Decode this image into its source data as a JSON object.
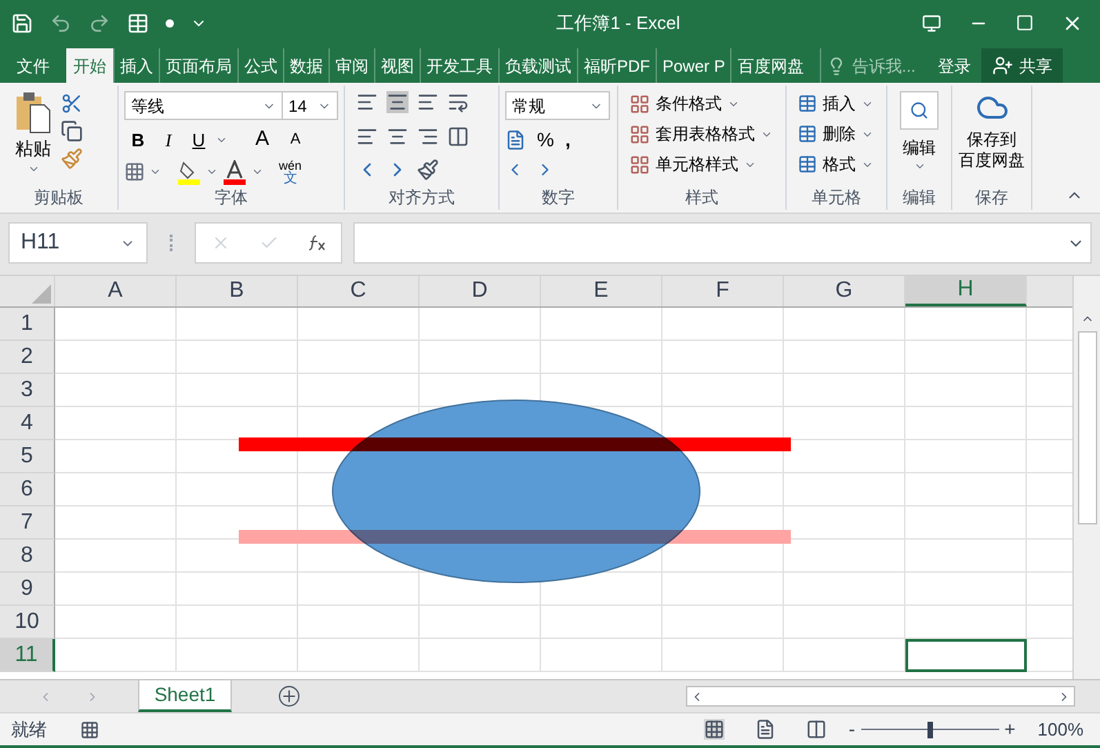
{
  "window": {
    "title": "工作簿1 - Excel"
  },
  "tabs": [
    {
      "label": "文件",
      "selected": false
    },
    {
      "label": "开始",
      "selected": true
    },
    {
      "label": "插入",
      "selected": false
    },
    {
      "label": "页面布局",
      "selected": false
    },
    {
      "label": "公式",
      "selected": false
    },
    {
      "label": "数据",
      "selected": false
    },
    {
      "label": "审阅",
      "selected": false
    },
    {
      "label": "视图",
      "selected": false
    },
    {
      "label": "开发工具",
      "selected": false
    },
    {
      "label": "负载测试",
      "selected": false
    },
    {
      "label": "福昕PDF",
      "selected": false
    },
    {
      "label": "Power P",
      "selected": false
    },
    {
      "label": "百度网盘",
      "selected": false
    }
  ],
  "tell_me": {
    "placeholder": "告诉我..."
  },
  "sign_in": "登录",
  "share": "共享",
  "ribbon": {
    "clipboard": {
      "label": "剪贴板",
      "paste": "粘贴"
    },
    "font": {
      "label": "字体",
      "font_name": "等线",
      "font_size": "14",
      "bold": "B",
      "italic": "I",
      "underline": "U",
      "grow": "A",
      "shrink": "A",
      "phonetic_top": "wén",
      "phonetic_bottom": "文"
    },
    "alignment": {
      "label": "对齐方式"
    },
    "number": {
      "label": "数字",
      "format": "常规",
      "percent": "%",
      "comma": ","
    },
    "styles": {
      "label": "样式",
      "items": [
        "条件格式",
        "套用表格格式",
        "单元格样式"
      ]
    },
    "cells": {
      "label": "单元格",
      "items": [
        "插入",
        "删除",
        "格式"
      ]
    },
    "editing": {
      "label": "编辑",
      "button": "编辑"
    },
    "save": {
      "label": "保存",
      "button_lines": [
        "保存到",
        "百度网盘"
      ]
    }
  },
  "name_box": "H11",
  "columns": [
    {
      "label": "A",
      "selected": false
    },
    {
      "label": "B",
      "selected": false
    },
    {
      "label": "C",
      "selected": false
    },
    {
      "label": "D",
      "selected": false
    },
    {
      "label": "E",
      "selected": false
    },
    {
      "label": "F",
      "selected": false
    },
    {
      "label": "G",
      "selected": false
    },
    {
      "label": "H",
      "selected": true
    }
  ],
  "rows": [
    {
      "label": "1",
      "selected": false
    },
    {
      "label": "2",
      "selected": false
    },
    {
      "label": "3",
      "selected": false
    },
    {
      "label": "4",
      "selected": false
    },
    {
      "label": "5",
      "selected": false
    },
    {
      "label": "6",
      "selected": false
    },
    {
      "label": "7",
      "selected": false
    },
    {
      "label": "8",
      "selected": false
    },
    {
      "label": "9",
      "selected": false
    },
    {
      "label": "10",
      "selected": false
    },
    {
      "label": "11",
      "selected": true
    }
  ],
  "shapes": [
    {
      "kind": "ellipse",
      "color": "#5b9bd5"
    },
    {
      "kind": "line",
      "color": "#ff0000"
    },
    {
      "kind": "line",
      "color": "#ffa3a3"
    }
  ],
  "sheets": [
    {
      "label": "Sheet1",
      "selected": true
    }
  ],
  "status": {
    "text": "就绪",
    "zoom_out": "-",
    "zoom_in": "+",
    "zoom": "100%",
    "zoom_slider": {
      "level": 0.5
    }
  }
}
